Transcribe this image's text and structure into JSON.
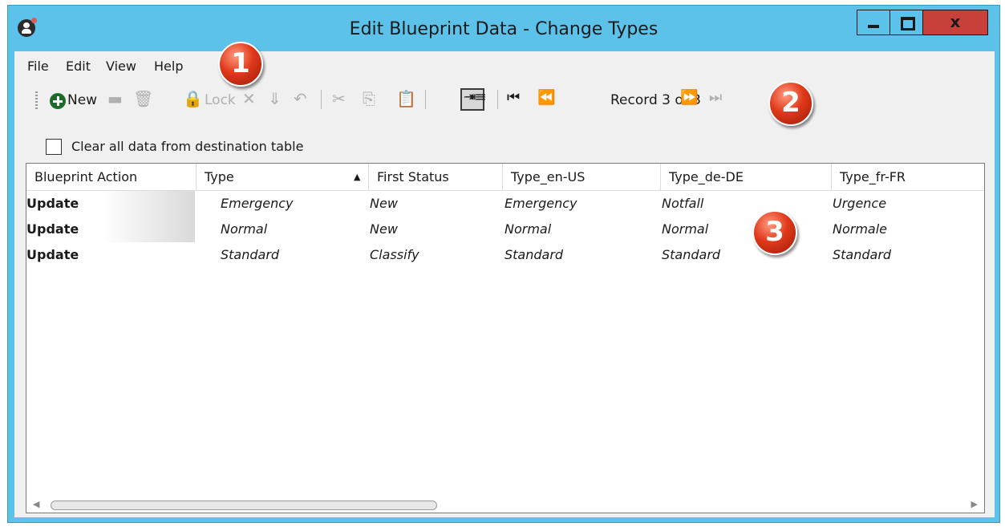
{
  "window": {
    "title": "Edit Blueprint Data - Change Types",
    "close_label": "x"
  },
  "menu": {
    "items": [
      "File",
      "Edit",
      "View",
      "Help"
    ]
  },
  "toolbar": {
    "new_label": "New",
    "lock_label": "Lock",
    "record_label": "Record 3 of 3"
  },
  "clear_option": {
    "label": "Clear all data from destination table",
    "checked": false
  },
  "grid": {
    "columns": [
      "Blueprint Action",
      "Type",
      "First Status",
      "Type_en-US",
      "Type_de-DE",
      "Type_fr-FR"
    ],
    "sorted_column": "Type",
    "rows": [
      [
        "Update",
        "Emergency",
        "New",
        "Emergency",
        "Notfall",
        "Urgence"
      ],
      [
        "Update",
        "Normal",
        "New",
        "Normal",
        "Normal",
        "Normale"
      ],
      [
        "Update",
        "Standard",
        "Classify",
        "Standard",
        "Standard",
        "Standard"
      ]
    ]
  },
  "badges": [
    "1",
    "2",
    "3"
  ],
  "colors": {
    "titlebar": "#5cc2e9",
    "close_button": "#c8403a",
    "badge": "#e0391a",
    "new_icon": "#1c6b2c"
  }
}
